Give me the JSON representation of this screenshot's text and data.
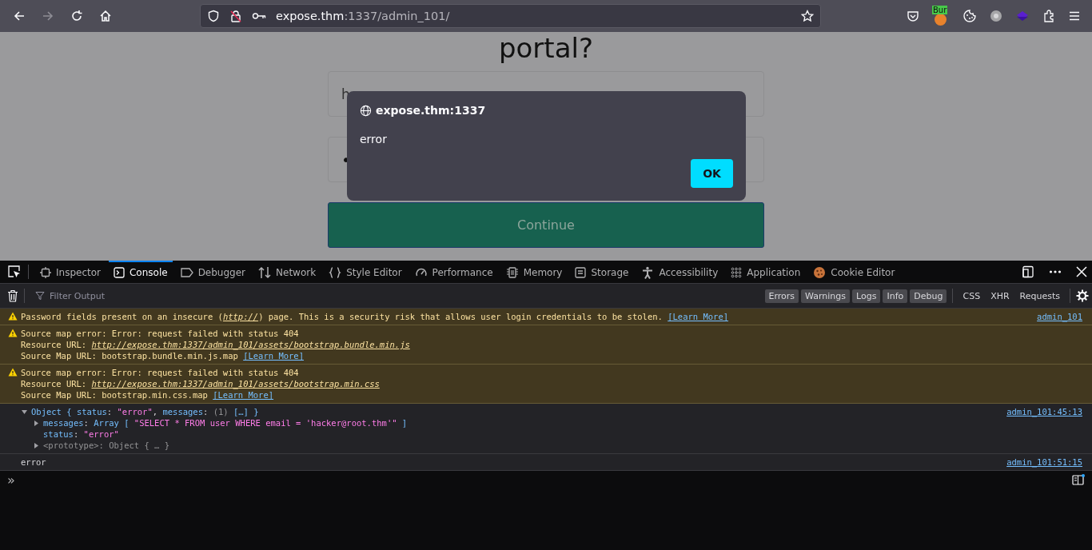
{
  "browser": {
    "nav": [
      {
        "kind": "back",
        "disabled": false
      },
      {
        "kind": "forward",
        "disabled": true
      },
      {
        "kind": "reload",
        "disabled": false
      },
      {
        "kind": "home",
        "disabled": false
      }
    ],
    "url": {
      "host": "expose.thm",
      "rest": ":1337/admin_101/"
    },
    "extension_badge": "Bur"
  },
  "page": {
    "heading": "portal?",
    "email_value": "h",
    "password_value": "•",
    "button": "Continue"
  },
  "dialog": {
    "origin": "expose.thm:1337",
    "message": "error",
    "button": "OK"
  },
  "devtools": {
    "tabs": [
      {
        "label": "Inspector",
        "selected": false
      },
      {
        "label": "Console",
        "selected": true
      },
      {
        "label": "Debugger",
        "selected": false
      },
      {
        "label": "Network",
        "selected": false
      },
      {
        "label": "Style Editor",
        "selected": false
      },
      {
        "label": "Performance",
        "selected": false
      },
      {
        "label": "Memory",
        "selected": false
      },
      {
        "label": "Storage",
        "selected": false
      },
      {
        "label": "Accessibility",
        "selected": false
      },
      {
        "label": "Application",
        "selected": false
      },
      {
        "label": "Cookie Editor",
        "selected": false
      }
    ],
    "filter": {
      "placeholder": "Filter Output"
    },
    "levels": [
      {
        "label": "Errors",
        "on": true
      },
      {
        "label": "Warnings",
        "on": true
      },
      {
        "label": "Logs",
        "on": true
      },
      {
        "label": "Info",
        "on": true
      },
      {
        "label": "Debug",
        "on": true
      }
    ],
    "extra_filters": [
      {
        "label": "CSS",
        "on": false
      },
      {
        "label": "XHR",
        "on": false
      },
      {
        "label": "Requests",
        "on": false
      }
    ],
    "messages": [
      {
        "kind": "warning",
        "source": "admin_101",
        "lines": [
          [
            {
              "kind": "plain",
              "t": "Password fields present on an insecure ("
            },
            {
              "kind": "url",
              "t": "http://"
            },
            {
              "kind": "plain",
              "t": ") page. This is a security risk that allows user login credentials to be stolen. "
            },
            {
              "kind": "link",
              "t": "[Learn More]"
            }
          ]
        ]
      },
      {
        "kind": "warning",
        "lines": [
          [
            {
              "kind": "plain",
              "t": "Source map error: Error: request failed with status 404"
            }
          ],
          [
            {
              "kind": "plain",
              "t": "Resource URL: "
            },
            {
              "kind": "url",
              "t": "http://expose.thm:1337/admin_101/assets/bootstrap.bundle.min.js"
            }
          ],
          [
            {
              "kind": "plain",
              "t": "Source Map URL: bootstrap.bundle.min.js.map "
            },
            {
              "kind": "link",
              "t": "[Learn More]"
            }
          ]
        ]
      },
      {
        "kind": "warning",
        "lines": [
          [
            {
              "kind": "plain",
              "t": "Source map error: Error: request failed with status 404"
            }
          ],
          [
            {
              "kind": "plain",
              "t": "Resource URL: "
            },
            {
              "kind": "url",
              "t": "http://expose.thm:1337/admin_101/assets/bootstrap.min.css"
            }
          ],
          [
            {
              "kind": "plain",
              "t": "Source Map URL: bootstrap.min.css.map "
            },
            {
              "kind": "link",
              "t": "[Learn More]"
            }
          ]
        ]
      },
      {
        "kind": "log",
        "source": "admin_101:45:13",
        "tree": {
          "expanded": true,
          "segments": [
            {
              "kind": "obj",
              "t": "Object { "
            },
            {
              "kind": "key",
              "t": "status"
            },
            {
              "kind": "plain",
              "t": ": "
            },
            {
              "kind": "str",
              "t": "\"error\""
            },
            {
              "kind": "plain",
              "t": ", "
            },
            {
              "kind": "key",
              "t": "messages"
            },
            {
              "kind": "plain",
              "t": ": "
            },
            {
              "kind": "muted",
              "t": "(1) "
            },
            {
              "kind": "obj",
              "t": "[…] }"
            }
          ],
          "children": [
            {
              "expanded": false,
              "segments": [
                {
                  "kind": "key",
                  "t": "messages"
                },
                {
                  "kind": "plain",
                  "t": ": "
                },
                {
                  "kind": "obj",
                  "t": "Array [ "
                },
                {
                  "kind": "str",
                  "t": "\"SELECT * FROM user WHERE email = 'hacker@root.thm'\""
                },
                {
                  "kind": "obj",
                  "t": " ]"
                }
              ]
            },
            {
              "segments": [
                {
                  "kind": "key",
                  "t": "status"
                },
                {
                  "kind": "plain",
                  "t": ": "
                },
                {
                  "kind": "str",
                  "t": "\"error\""
                }
              ]
            },
            {
              "expanded": false,
              "segments": [
                {
                  "kind": "muted",
                  "t": "<prototype>: Object { … }"
                }
              ]
            }
          ]
        }
      },
      {
        "kind": "log",
        "source": "admin_101:51:15",
        "lines": [
          [
            {
              "kind": "plain",
              "t": "error"
            }
          ]
        ]
      }
    ],
    "prompt": "»"
  }
}
